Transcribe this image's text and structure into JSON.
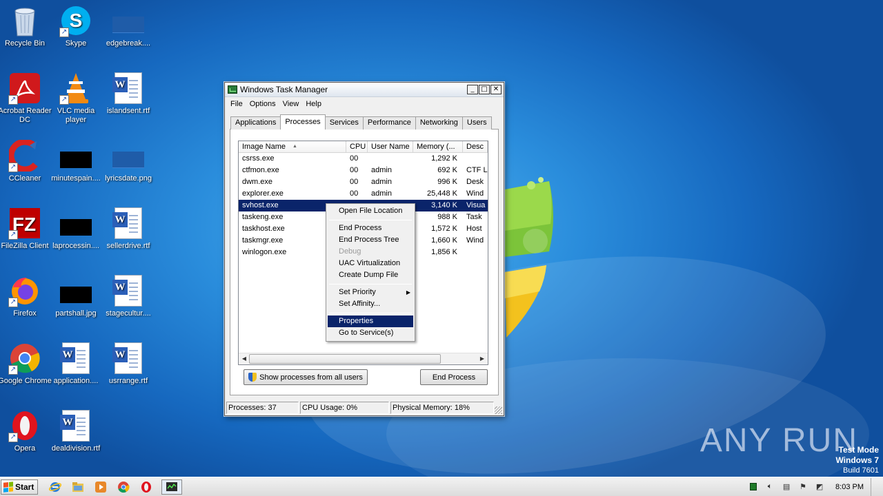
{
  "desktop": {
    "icons": [
      {
        "label": "Recycle Bin",
        "icon": "recycle-bin-icon"
      },
      {
        "label": "Skype",
        "icon": "skype-icon"
      },
      {
        "label": "edgebreak....",
        "icon": "image-thumbnail-icon"
      },
      {
        "label": "Acrobat Reader DC",
        "icon": "acrobat-icon"
      },
      {
        "label": "VLC media player",
        "icon": "vlc-icon"
      },
      {
        "label": "islandsent.rtf",
        "icon": "word-document-icon"
      },
      {
        "label": "CCleaner",
        "icon": "ccleaner-icon"
      },
      {
        "label": "minutespain....",
        "icon": "image-thumbnail-icon"
      },
      {
        "label": "lyricsdate.png",
        "icon": "image-thumbnail-icon"
      },
      {
        "label": "FileZilla Client",
        "icon": "filezilla-icon"
      },
      {
        "label": "laprocessin....",
        "icon": "image-thumbnail-icon"
      },
      {
        "label": "sellerdrive.rtf",
        "icon": "word-document-icon"
      },
      {
        "label": "Firefox",
        "icon": "firefox-icon"
      },
      {
        "label": "partshall.jpg",
        "icon": "image-thumbnail-icon"
      },
      {
        "label": "stagecultur....",
        "icon": "word-document-icon"
      },
      {
        "label": "Google Chrome",
        "icon": "chrome-icon"
      },
      {
        "label": "application....",
        "icon": "word-document-icon"
      },
      {
        "label": "usrrange.rtf",
        "icon": "word-document-icon"
      },
      {
        "label": "Opera",
        "icon": "opera-icon"
      },
      {
        "label": "dealdivision.rtf",
        "icon": "word-document-icon"
      }
    ],
    "watermark": "ANY RUN",
    "test_mode": {
      "line1": "Test Mode",
      "line2": "Windows 7",
      "line3": "Build 7601"
    }
  },
  "task_manager": {
    "title": "Windows Task Manager",
    "window_buttons": {
      "minimize": "_",
      "maximize": "□",
      "close": "✕"
    },
    "menu": [
      "File",
      "Options",
      "View",
      "Help"
    ],
    "tabs": [
      "Applications",
      "Processes",
      "Services",
      "Performance",
      "Networking",
      "Users"
    ],
    "active_tab": "Processes",
    "columns": [
      "Image Name",
      "CPU",
      "User Name",
      "Memory (...",
      "Desc"
    ],
    "sort_indicator": "▲",
    "processes": [
      {
        "name": "csrss.exe",
        "cpu": "00",
        "user": "",
        "memory": "1,292 K",
        "desc": ""
      },
      {
        "name": "ctfmon.exe",
        "cpu": "00",
        "user": "admin",
        "memory": "692 K",
        "desc": "CTF L"
      },
      {
        "name": "dwm.exe",
        "cpu": "00",
        "user": "admin",
        "memory": "996 K",
        "desc": "Desk"
      },
      {
        "name": "explorer.exe",
        "cpu": "00",
        "user": "admin",
        "memory": "25,448 K",
        "desc": "Wind"
      },
      {
        "name": "svhost.exe",
        "cpu": "",
        "user": "",
        "memory": "3,140 K",
        "desc": "Visua"
      },
      {
        "name": "taskeng.exe",
        "cpu": "",
        "user": "",
        "memory": "988 K",
        "desc": "Task"
      },
      {
        "name": "taskhost.exe",
        "cpu": "",
        "user": "",
        "memory": "1,572 K",
        "desc": "Host"
      },
      {
        "name": "taskmgr.exe",
        "cpu": "",
        "user": "",
        "memory": "1,660 K",
        "desc": "Wind"
      },
      {
        "name": "winlogon.exe",
        "cpu": "",
        "user": "",
        "memory": "1,856 K",
        "desc": ""
      }
    ],
    "selected_process": "svhost.exe",
    "show_all_button": "Show processes from all users",
    "end_process_button": "End Process",
    "status": {
      "processes": "Processes: 37",
      "cpu": "CPU Usage: 0%",
      "memory": "Physical Memory: 18%"
    }
  },
  "context_menu": {
    "items": [
      {
        "label": "Open File Location",
        "disabled": false
      },
      {
        "sep": true
      },
      {
        "label": "End Process",
        "disabled": false
      },
      {
        "label": "End Process Tree",
        "disabled": false
      },
      {
        "label": "Debug",
        "disabled": true
      },
      {
        "label": "UAC Virtualization",
        "disabled": false
      },
      {
        "label": "Create Dump File",
        "disabled": false
      },
      {
        "sep": true
      },
      {
        "label": "Set Priority",
        "disabled": false,
        "submenu": true
      },
      {
        "label": "Set Affinity...",
        "disabled": false
      },
      {
        "sep": true
      },
      {
        "label": "Properties",
        "disabled": false,
        "highlighted": true
      },
      {
        "label": "Go to Service(s)",
        "disabled": false
      }
    ]
  },
  "taskbar": {
    "start_label": "Start",
    "quick_launch": [
      "internet-explorer-icon",
      "folder-icon",
      "media-player-icon",
      "chrome-icon",
      "opera-icon",
      "task-manager-icon"
    ],
    "clock": "8:03 PM"
  },
  "colors": {
    "selection": "#0a246a",
    "desktop_blue": "#1a6fc4"
  }
}
